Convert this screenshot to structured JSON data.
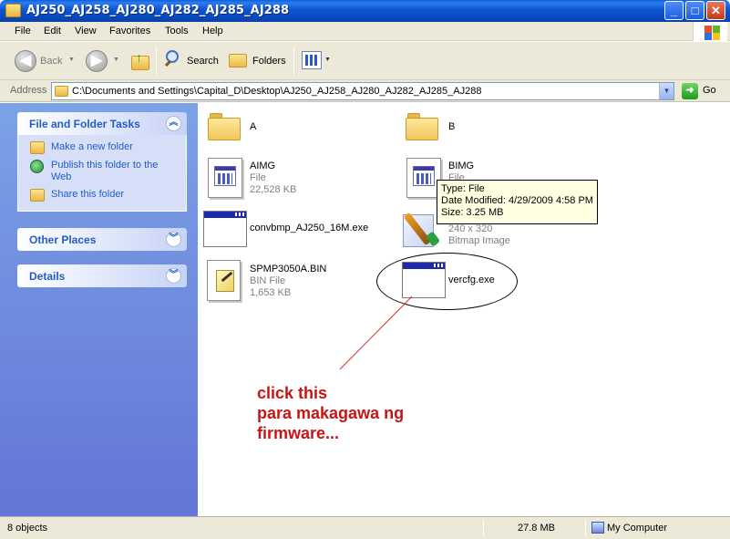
{
  "window": {
    "title": "AJ250_AJ258_AJ280_AJ282_AJ285_AJ288",
    "controls": [
      "_",
      "□",
      "✕"
    ]
  },
  "menu": [
    "File",
    "Edit",
    "View",
    "Favorites",
    "Tools",
    "Help"
  ],
  "toolbar": {
    "back_label": "Back",
    "search_label": "Search",
    "folders_label": "Folders"
  },
  "address": {
    "label": "Address",
    "value": "C:\\Documents and Settings\\Capital_D\\Desktop\\AJ250_AJ258_AJ280_AJ282_AJ285_AJ288",
    "go_label": "Go"
  },
  "tasks_panel": {
    "title": "File and Folder Tasks",
    "items": [
      "Make a new folder",
      "Publish this folder to the Web",
      "Share this folder"
    ]
  },
  "other_places": {
    "title": "Other Places"
  },
  "details": {
    "title": "Details"
  },
  "files": [
    {
      "name": "A",
      "type": "",
      "size": ""
    },
    {
      "name": "B",
      "type": "",
      "size": ""
    },
    {
      "name": "AIMG",
      "type": "File",
      "size": "22,528 KB"
    },
    {
      "name": "BIMG",
      "type": "File",
      "size": ""
    },
    {
      "name": "convbmp_AJ250_16M.exe",
      "type": "",
      "size": ""
    },
    {
      "name": "",
      "type": "240 x 320",
      "size": "Bitmap Image"
    },
    {
      "name": "SPMP3050A.BIN",
      "type": "BIN File",
      "size": "1,653 KB"
    },
    {
      "name": "vercfg.exe",
      "type": "",
      "size": ""
    }
  ],
  "tooltip": {
    "line1": "Type: File",
    "line2": "Date Modified: 4/29/2009 4:58 PM",
    "line3": "Size: 3.25 MB"
  },
  "annotation": {
    "line1": "click this",
    "line2": "para makagawa ng",
    "line3": "firmware..."
  },
  "status": {
    "objects": "8 objects",
    "size": "27.8 MB",
    "zone": "My Computer"
  }
}
